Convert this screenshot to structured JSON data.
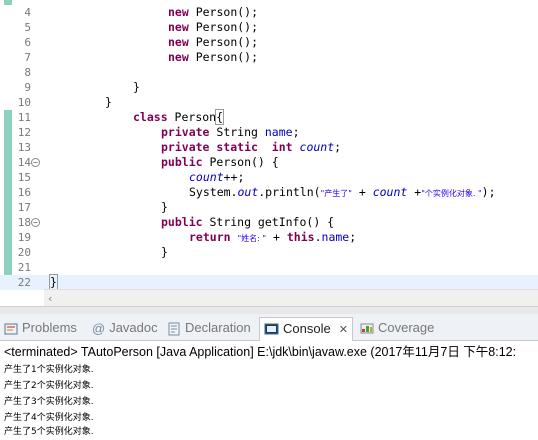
{
  "editor": {
    "lines": [
      {
        "num": "4",
        "fold": false
      },
      {
        "num": "5",
        "fold": false
      },
      {
        "num": "6",
        "fold": false
      },
      {
        "num": "7",
        "fold": false
      },
      {
        "num": "8",
        "fold": false
      },
      {
        "num": "9",
        "fold": false
      },
      {
        "num": "10",
        "fold": false
      },
      {
        "num": "11",
        "fold": false
      },
      {
        "num": "12",
        "fold": false
      },
      {
        "num": "13",
        "fold": false
      },
      {
        "num": "14",
        "fold": true
      },
      {
        "num": "15",
        "fold": false
      },
      {
        "num": "16",
        "fold": false
      },
      {
        "num": "17",
        "fold": false
      },
      {
        "num": "18",
        "fold": true
      },
      {
        "num": "19",
        "fold": false
      },
      {
        "num": "20",
        "fold": false
      },
      {
        "num": "21",
        "fold": false
      },
      {
        "num": "22",
        "fold": false
      }
    ],
    "code": {
      "l4_new": "new",
      "l4_rest": " Person();",
      "l5_new": "new",
      "l5_rest": " Person();",
      "l6_new": "new",
      "l6_rest": " Person();",
      "l7_new": "new",
      "l7_rest": " Person();",
      "l9": "}",
      "l10": "}",
      "l11_kw": "class",
      "l11_name": " Person",
      "l11_brace": "{",
      "l12_kw": "private",
      "l12_type": " String ",
      "l12_field": "name",
      "l12_end": ";",
      "l13_kw": "private static",
      "l13_sp": "  ",
      "l13_kw2": "int",
      "l13_sp2": " ",
      "l13_field": "count",
      "l13_end": ";",
      "l14_kw": "public",
      "l14_rest": " Person() {",
      "l15_field": "count",
      "l15_rest": "++;",
      "l16_a": "System.",
      "l16_out": "out",
      "l16_b": ".println(",
      "l16_s1": "\"产生了\"",
      "l16_c": " + ",
      "l16_cnt": "count",
      "l16_d": " +",
      "l16_s2": "\"个实例化对象. \"",
      "l16_e": ");",
      "l17": "}",
      "l18_kw": "public",
      "l18_rest": " String getInfo() {",
      "l19_kw": "return",
      "l19_sp": " ",
      "l19_s": "\"姓名: \"",
      "l19_plus": " + ",
      "l19_this": "this",
      "l19_dot": ".",
      "l19_name": "name",
      "l19_end": ";",
      "l20": "}",
      "l22": "}"
    }
  },
  "tabs": [
    {
      "label": "Problems",
      "icon": "problems-icon"
    },
    {
      "label": "Javadoc",
      "icon": "at-icon"
    },
    {
      "label": "Declaration",
      "icon": "declaration-icon"
    },
    {
      "label": "Console",
      "icon": "console-icon",
      "close": "✕"
    },
    {
      "label": "Coverage",
      "icon": "coverage-icon"
    }
  ],
  "console": {
    "status": "<terminated> TAutoPerson [Java Application] E:\\jdk\\bin\\javaw.exe (2017年11月7日 下午8:12:",
    "output": [
      "产生了1个实例化对象.",
      "产生了2个实例化对象.",
      "产生了3个实例化对象.",
      "产生了4个实例化对象.",
      "产生了5个实例化对象."
    ]
  },
  "colors": {
    "keyword": "#7f0055",
    "string": "#2a00ff",
    "field": "#0000c0",
    "marker": "#8fd1c0",
    "current_line": "#e8f2fe"
  }
}
